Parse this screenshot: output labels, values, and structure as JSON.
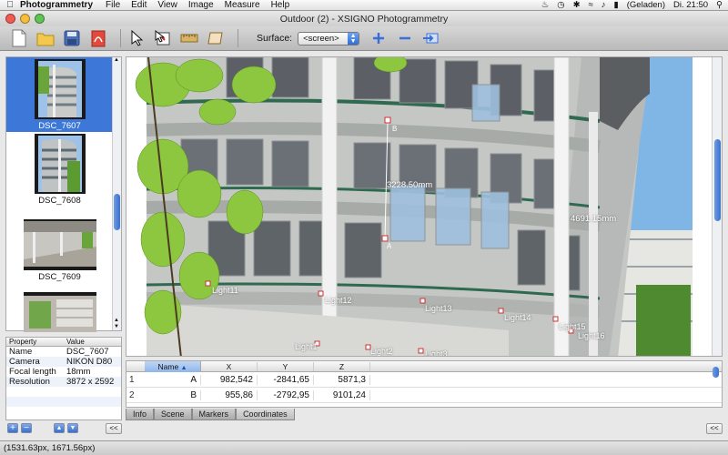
{
  "menubar": {
    "app": "Photogrammetry",
    "items": [
      "File",
      "Edit",
      "View",
      "Image",
      "Measure",
      "Help"
    ],
    "battery": "(Geladen)",
    "clock": "Di. 21:50"
  },
  "window": {
    "title": "Outdoor (2) - XSIGNO Photogrammetry"
  },
  "toolbar": {
    "surface_label": "Surface:",
    "surface_value": "<screen>"
  },
  "thumbnails": [
    {
      "label": "DSC_7607",
      "selected": true
    },
    {
      "label": "DSC_7608",
      "selected": false
    },
    {
      "label": "DSC_7609",
      "selected": false
    },
    {
      "label": "",
      "selected": false
    }
  ],
  "properties": {
    "header": [
      "Property",
      "Value"
    ],
    "rows": [
      {
        "k": "Name",
        "v": "DSC_7607"
      },
      {
        "k": "Camera",
        "v": "NIKON D80"
      },
      {
        "k": "Focal length",
        "v": "18mm"
      },
      {
        "k": "Resolution",
        "v": "3872 x 2592"
      }
    ]
  },
  "viewer": {
    "distances": [
      "3228.50mm",
      "4691.15mm"
    ],
    "point_labels": [
      "A",
      "B"
    ],
    "lights": [
      "Light11",
      "Light12",
      "Light13",
      "Light14",
      "Light15",
      "Light16",
      "Light1",
      "Light2",
      "Light3"
    ]
  },
  "coords": {
    "headers": [
      "Name",
      "X",
      "Y",
      "Z"
    ],
    "rows": [
      {
        "idx": "1",
        "name": "A",
        "x": "982,542",
        "y": "-2841,65",
        "z": "5871,3"
      },
      {
        "idx": "2",
        "name": "B",
        "x": "955,86",
        "y": "-2792,95",
        "z": "9101,24"
      }
    ]
  },
  "tabs": [
    "Info",
    "Scene",
    "Markers",
    "Coordinates"
  ],
  "active_tab": "Coordinates",
  "status": "(1531.63px, 1671.56px)"
}
